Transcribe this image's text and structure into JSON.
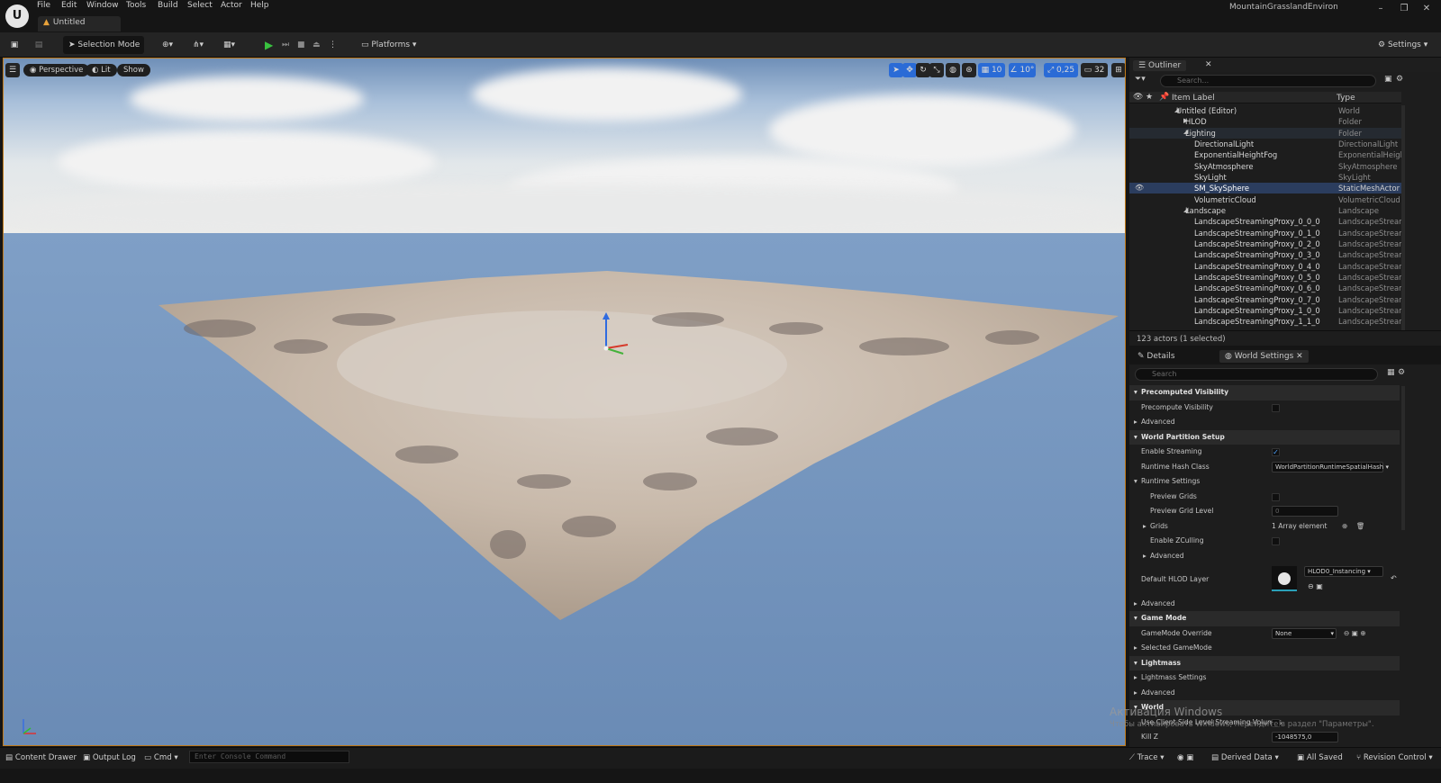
{
  "app": {
    "project_name": "MountainGrasslandEnvironm",
    "logo_label": "U",
    "tab_title": "Untitled"
  },
  "menu": [
    "File",
    "Edit",
    "Window",
    "Tools",
    "Build",
    "Select",
    "Actor",
    "Help"
  ],
  "toolbar": {
    "selection_mode": "Selection Mode",
    "platforms": "Platforms",
    "settings": "Settings"
  },
  "viewport": {
    "view_mode": "Perspective",
    "lighting": "Lit",
    "show": "Show",
    "grid_snap": "10",
    "rot_snap": "10°",
    "scale_snap": "0,25",
    "camera_speed": "32"
  },
  "outliner": {
    "tab": "Outliner",
    "search_placeholder": "Search...",
    "col_label": "Item Label",
    "col_type": "Type",
    "rows": [
      {
        "label": "Untitled (Editor)",
        "type": "World"
      },
      {
        "label": "HLOD",
        "type": "Folder"
      },
      {
        "label": "Lighting",
        "type": "Folder"
      },
      {
        "label": "DirectionalLight",
        "type": "DirectionalLight"
      },
      {
        "label": "ExponentialHeightFog",
        "type": "ExponentialHeightF"
      },
      {
        "label": "SkyAtmosphere",
        "type": "SkyAtmosphere"
      },
      {
        "label": "SkyLight",
        "type": "SkyLight"
      },
      {
        "label": "SM_SkySphere",
        "type": "StaticMeshActor"
      },
      {
        "label": "VolumetricCloud",
        "type": "VolumetricCloud"
      },
      {
        "label": "Landscape",
        "type": "Landscape"
      },
      {
        "label": "LandscapeStreamingProxy_0_0_0",
        "type": "LandscapeStreamin"
      },
      {
        "label": "LandscapeStreamingProxy_0_1_0",
        "type": "LandscapeStreamin"
      },
      {
        "label": "LandscapeStreamingProxy_0_2_0",
        "type": "LandscapeStreamin"
      },
      {
        "label": "LandscapeStreamingProxy_0_3_0",
        "type": "LandscapeStreamin"
      },
      {
        "label": "LandscapeStreamingProxy_0_4_0",
        "type": "LandscapeStreamin"
      },
      {
        "label": "LandscapeStreamingProxy_0_5_0",
        "type": "LandscapeStreamin"
      },
      {
        "label": "LandscapeStreamingProxy_0_6_0",
        "type": "LandscapeStreamin"
      },
      {
        "label": "LandscapeStreamingProxy_0_7_0",
        "type": "LandscapeStreamin"
      },
      {
        "label": "LandscapeStreamingProxy_1_0_0",
        "type": "LandscapeStreamin"
      },
      {
        "label": "LandscapeStreamingProxy_1_1_0",
        "type": "LandscapeStreamin"
      }
    ],
    "actor_count": "123 actors (1 selected)"
  },
  "details": {
    "tab_details": "Details",
    "tab_world_settings": "World Settings",
    "search_placeholder": "Search",
    "rows": [
      {
        "label": "Precomputed Visibility",
        "kind": "category"
      },
      {
        "label": "Precompute Visibility",
        "kind": "check",
        "checked": false
      },
      {
        "label": "Advanced",
        "kind": "expander"
      },
      {
        "label": "World Partition Setup",
        "kind": "category"
      },
      {
        "label": "Enable Streaming",
        "kind": "check",
        "checked": true
      },
      {
        "label": "Runtime Hash Class",
        "kind": "dropdown",
        "value": "WorldPartitionRuntimeSpatialHash"
      },
      {
        "label": "Runtime Settings",
        "kind": "subgroup"
      },
      {
        "label": "Preview Grids",
        "kind": "check",
        "checked": false,
        "indent": true
      },
      {
        "label": "Preview Grid Level",
        "kind": "number",
        "value": "0",
        "indent": true
      },
      {
        "label": "Grids",
        "kind": "array",
        "value": "1 Array element",
        "indent": true
      },
      {
        "label": "Enable ZCulling",
        "kind": "check",
        "checked": false,
        "indent": true
      },
      {
        "label": "Advanced",
        "kind": "expander",
        "indent": true
      },
      {
        "label": "Default HLOD Layer",
        "kind": "asset",
        "value": "HLOD0_Instancing"
      },
      {
        "label": "Advanced",
        "kind": "expander"
      },
      {
        "label": "Game Mode",
        "kind": "category"
      },
      {
        "label": "GameMode Override",
        "kind": "dropdown",
        "value": "None"
      },
      {
        "label": "Selected GameMode",
        "kind": "expander"
      },
      {
        "label": "Lightmass",
        "kind": "category"
      },
      {
        "label": "Lightmass Settings",
        "kind": "expander"
      },
      {
        "label": "Advanced",
        "kind": "expander"
      },
      {
        "label": "World",
        "kind": "category"
      },
      {
        "label": "Use Client Side Level Streaming Volumes",
        "kind": "check",
        "checked": false
      },
      {
        "label": "Kill Z",
        "kind": "number",
        "value": "-1048575,0"
      }
    ]
  },
  "statusbar": {
    "content_drawer": "Content Drawer",
    "output_log": "Output Log",
    "cmd": "Cmd",
    "console_placeholder": "Enter Console Command",
    "trace": "Trace",
    "derived_data": "Derived Data",
    "all_saved": "All Saved",
    "revision_control": "Revision Control"
  },
  "watermark": {
    "title": "Активация Windows",
    "subtitle": "Чтобы активировать Windows, перейдите в раздел \"Параметры\"."
  }
}
